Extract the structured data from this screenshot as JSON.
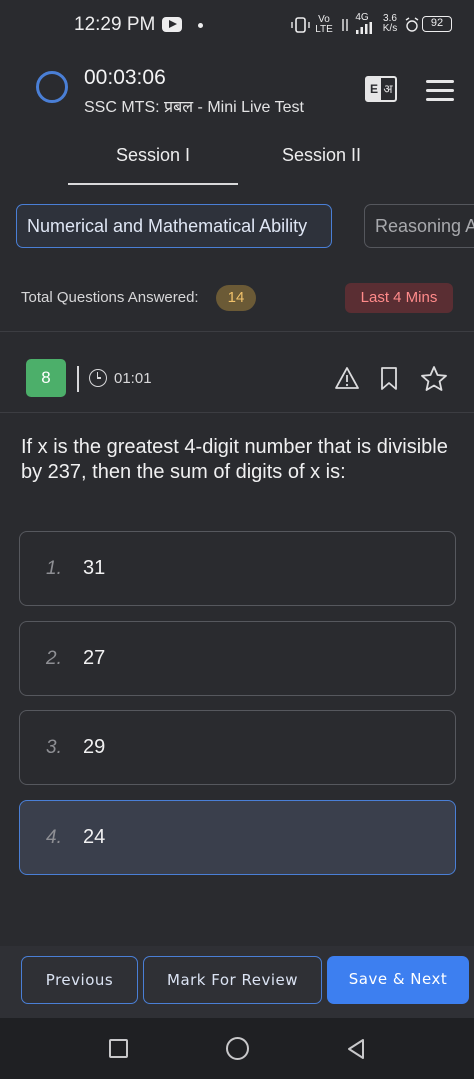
{
  "status_bar": {
    "time": "12:29 PM",
    "volte_top": "Vo",
    "volte_bottom": "LTE",
    "network": "4G",
    "speed_top": "3.6",
    "speed_bottom": "K/s",
    "battery": "92"
  },
  "header": {
    "timer": "00:03:06",
    "subtitle": "SSC MTS: प्रबल - Mini Live Test",
    "lang_left": "E",
    "lang_right": "अ"
  },
  "tabs": [
    {
      "label": "Session I",
      "active": true
    },
    {
      "label": "Session II",
      "active": false
    }
  ],
  "sections": [
    {
      "label": "Numerical and Mathematical Ability",
      "active": true
    },
    {
      "label": "Reasoning A",
      "active": false
    }
  ],
  "summary": {
    "answered_label": "Total Questions Answered:",
    "answered_count": "14",
    "time_warning": "Last 4 Mins"
  },
  "question": {
    "number": "8",
    "time": "01:01",
    "text": "If x is the greatest 4-digit number that is divisible by 237, then the sum of digits of x is:",
    "options": [
      {
        "num": "1.",
        "value": "31",
        "selected": false
      },
      {
        "num": "2.",
        "value": "27",
        "selected": false
      },
      {
        "num": "3.",
        "value": "29",
        "selected": false
      },
      {
        "num": "4.",
        "value": "24",
        "selected": true
      }
    ]
  },
  "footer": {
    "previous": "Previous",
    "mark_review": "Mark For Review",
    "save_next": "Save & Next"
  },
  "colors": {
    "background": "#2a2b2f",
    "accent": "#4a7fd6",
    "primary_button": "#3d7ff0",
    "question_badge": "#4caf6a",
    "answered_badge": "#6b5a36",
    "warning_badge": "#5a2e33"
  },
  "icons": [
    "youtube-icon",
    "vibrate-icon",
    "signal-icon",
    "alarm-icon",
    "battery-icon",
    "progress-ring-icon",
    "language-toggle-icon",
    "menu-icon",
    "clock-icon",
    "warning-icon",
    "bookmark-icon",
    "star-icon",
    "nav-recents-icon",
    "nav-home-icon",
    "nav-back-icon"
  ]
}
